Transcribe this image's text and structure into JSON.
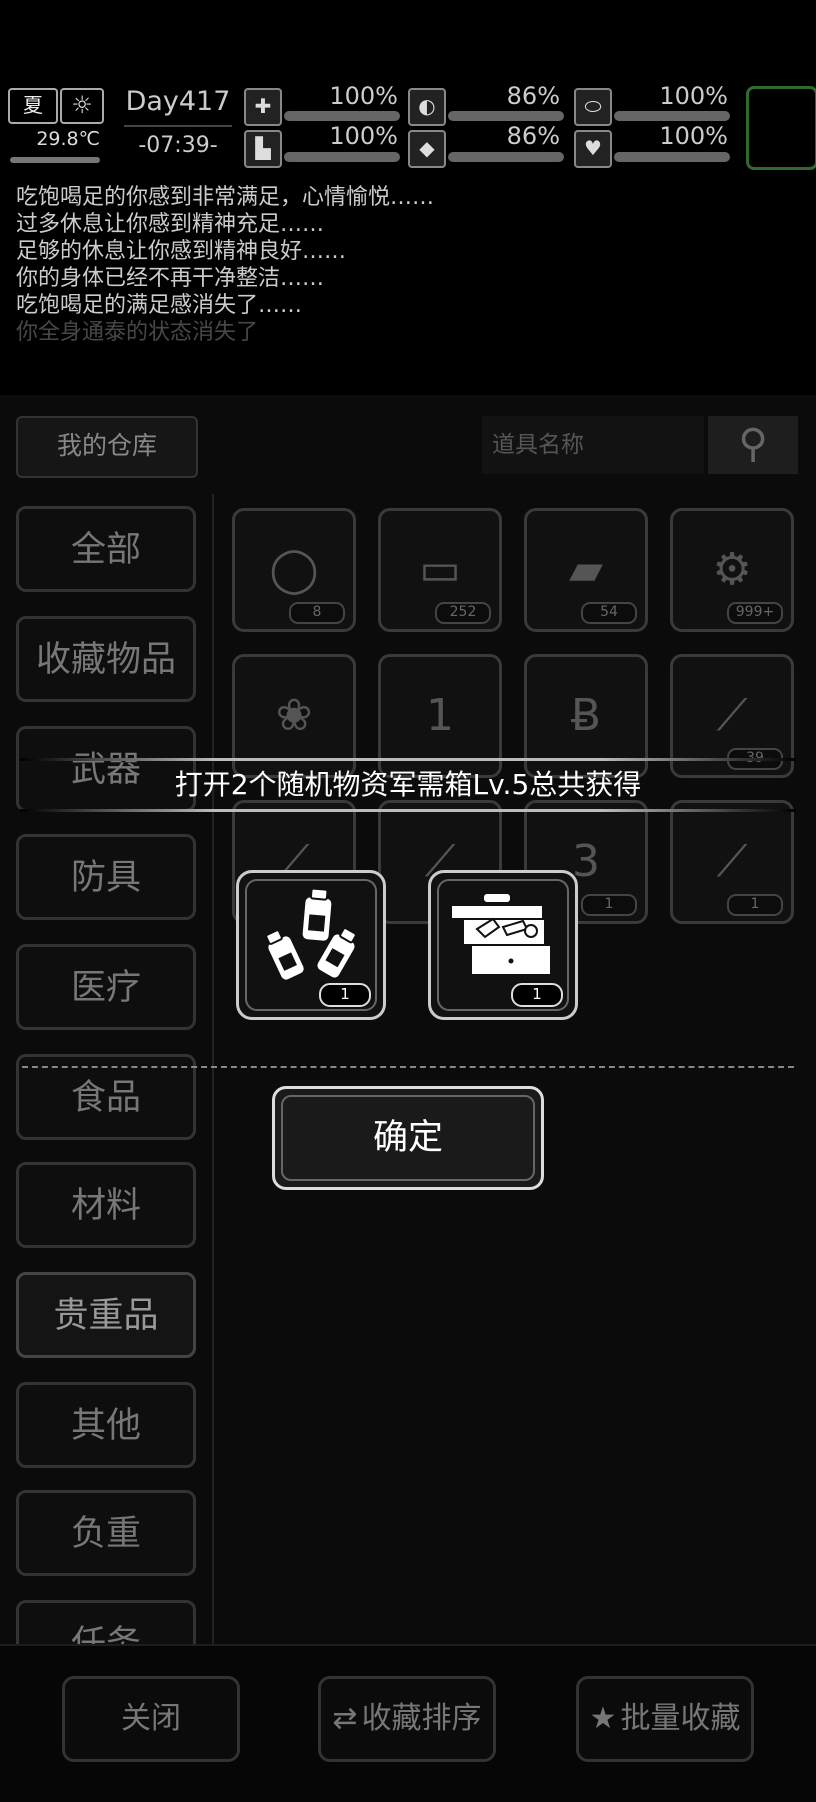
{
  "status": {
    "season": "夏",
    "temperature": "29.8℃",
    "day": "Day417",
    "time": "-07:39-",
    "stats": [
      {
        "icon": "medkit-icon",
        "glyph": "✚",
        "value": "100%"
      },
      {
        "icon": "stomach-icon",
        "glyph": "◐",
        "value": "86%"
      },
      {
        "icon": "pill-icon",
        "glyph": "⬭",
        "value": "100%"
      },
      {
        "icon": "boot-icon",
        "glyph": "▙",
        "value": "100%"
      },
      {
        "icon": "water-drop-icon",
        "glyph": "💧",
        "value": "86%"
      },
      {
        "icon": "heart-icon",
        "glyph": "♥",
        "value": "100%"
      }
    ]
  },
  "log": [
    "吃饱喝足的你感到非常满足，心情愉悦……",
    "过多休息让你感到精神充足……",
    "足够的休息让你感到精神良好……",
    "你的身体已经不再干净整洁……",
    "吃饱喝足的满足感消失了……",
    "你全身通泰的状态消失了"
  ],
  "warehouse": {
    "tab_label": "我的仓库",
    "search_placeholder": "道具名称",
    "categories": [
      "全部",
      "收藏物品",
      "武器",
      "防具",
      "医疗",
      "食品",
      "材料",
      "贵重品",
      "其他",
      "负重",
      "任务"
    ],
    "items": [
      {
        "icon": "ring-icon",
        "glyph": "◯",
        "count": "8"
      },
      {
        "icon": "cash-stack-icon",
        "glyph": "▭",
        "count": "252"
      },
      {
        "icon": "gold-bars-icon",
        "glyph": "▰",
        "count": "54"
      },
      {
        "icon": "wrench-coin-icon",
        "glyph": "⚙",
        "count": "999+"
      },
      {
        "icon": "rose-card-icon",
        "glyph": "❀",
        "count": ""
      },
      {
        "icon": "level-1-card-icon",
        "glyph": "1",
        "count": ""
      },
      {
        "icon": "bitcoin-icon",
        "glyph": "Ƀ",
        "count": ""
      },
      {
        "icon": "test-tube-7-icon",
        "glyph": "⟋",
        "count": "39"
      },
      {
        "icon": "test-tube-6-icon",
        "glyph": "⟋",
        "count": ""
      },
      {
        "icon": "test-tube-5-icon",
        "glyph": "⟋",
        "count": ""
      },
      {
        "icon": "level-3-card-icon",
        "glyph": "3",
        "count": "1"
      },
      {
        "icon": "test-tube-2-icon",
        "glyph": "⟋",
        "count": "1"
      }
    ]
  },
  "bottom": {
    "close_label": "关闭",
    "sort_label": "收藏排序",
    "batch_label": "批量收藏"
  },
  "dialog": {
    "title": "打开2个随机物资军需箱Lv.5总共获得",
    "rewards": [
      {
        "icon": "bottles-icon",
        "count": "1"
      },
      {
        "icon": "toolbox-icon",
        "count": "1"
      }
    ],
    "confirm_label": "确定"
  }
}
